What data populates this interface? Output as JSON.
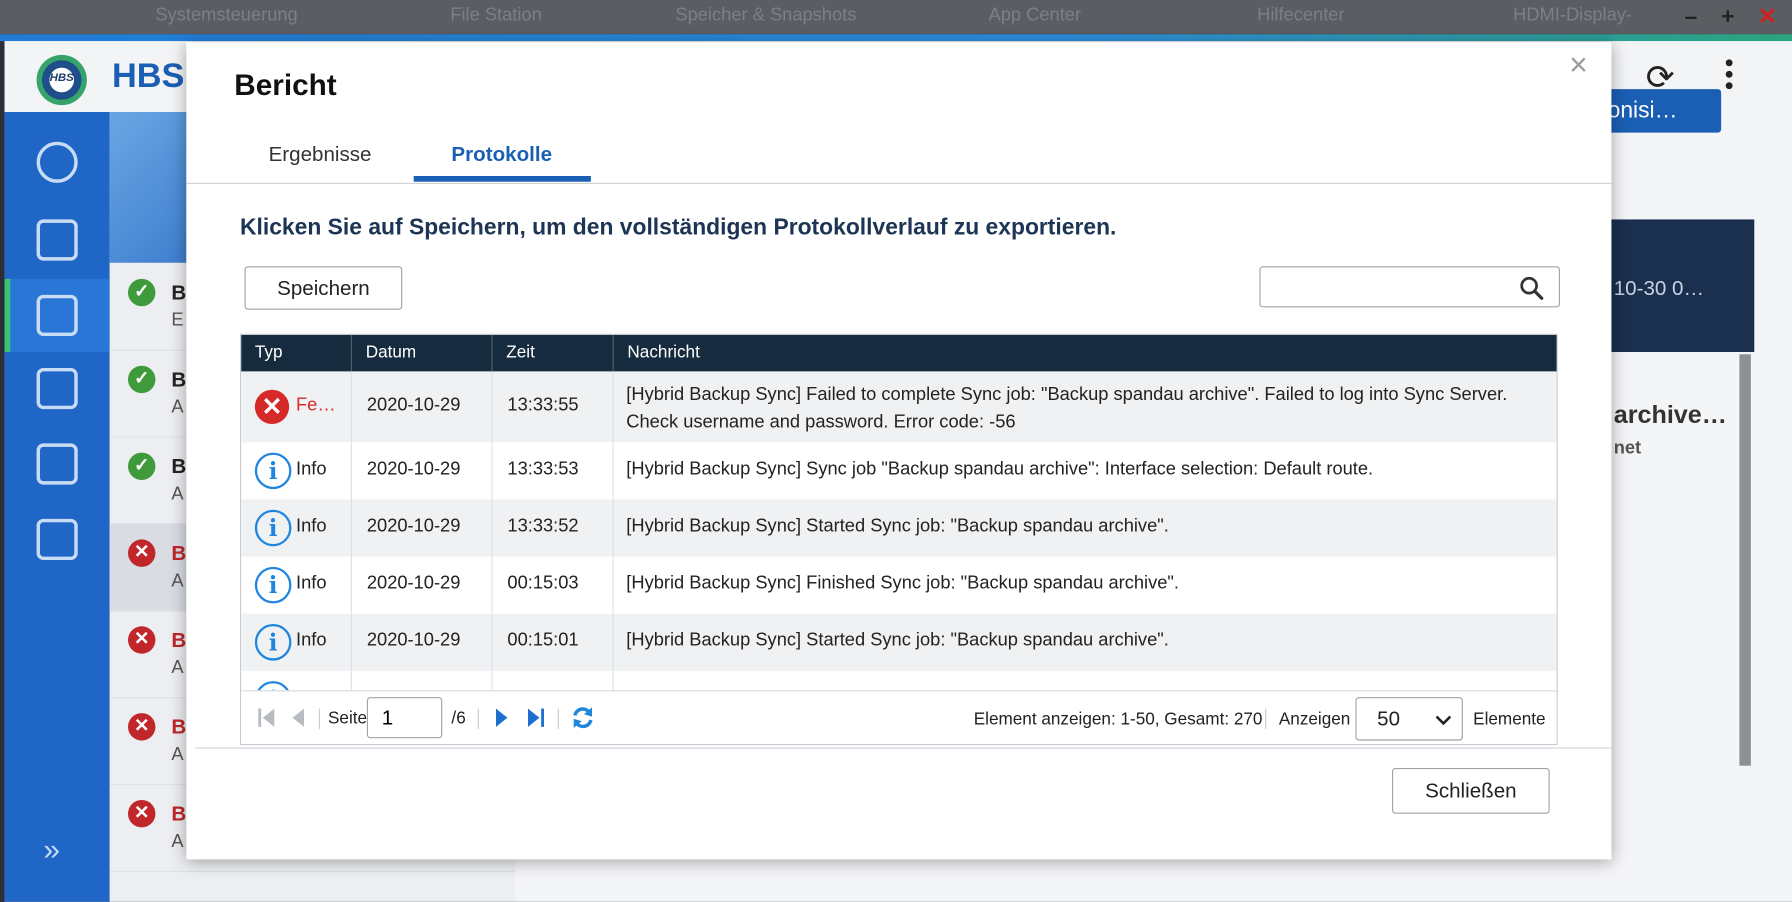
{
  "system_bar": {
    "items": [
      "Systemsteuerung",
      "File Station",
      "Speicher & Snapshots",
      "App Center",
      "Hilfecenter",
      "HDMI-Display-"
    ],
    "minimize_label": "–",
    "maximize_label": "+",
    "close_label": "✕"
  },
  "app": {
    "name": "HBS",
    "logo_text": "HBS",
    "sync_button_label": "ronisi…",
    "detail_date": "10-30 0…",
    "detail_title": "archive…",
    "detail_sub": "net",
    "collapse_label": "»",
    "job_list": [
      {
        "status": "ok",
        "title": "B",
        "sub": "E"
      },
      {
        "status": "ok",
        "title": "B",
        "sub": "A"
      },
      {
        "status": "ok",
        "title": "B",
        "sub": "A"
      },
      {
        "status": "err",
        "title": "B",
        "sub": "A"
      },
      {
        "status": "err",
        "title": "B",
        "sub": "A"
      },
      {
        "status": "err",
        "title": "B",
        "sub": "A"
      },
      {
        "status": "err",
        "title": "B",
        "sub": "A"
      }
    ]
  },
  "dialog": {
    "title": "Bericht",
    "close_icon_label": "×",
    "tabs": [
      {
        "label": "Ergebnisse",
        "active": false
      },
      {
        "label": "Protokolle",
        "active": true
      }
    ],
    "hint": "Klicken Sie auf Speichern, um den vollständigen Protokollverlauf zu exportieren.",
    "save_label": "Speichern",
    "search_placeholder": "",
    "table": {
      "columns": [
        "Typ",
        "Datum",
        "Zeit",
        "Nachricht"
      ],
      "rows": [
        {
          "type": "Fe…",
          "level": "error",
          "date": "2020-10-29",
          "time": "13:33:55",
          "message": "[Hybrid Backup Sync] Failed to complete Sync job: \"Backup spandau archive\". Failed to log into Sync Server. Check username and password. Error code: -56"
        },
        {
          "type": "Info",
          "level": "info",
          "date": "2020-10-29",
          "time": "13:33:53",
          "message": "[Hybrid Backup Sync] Sync job \"Backup spandau archive\": Interface selection: Default route."
        },
        {
          "type": "Info",
          "level": "info",
          "date": "2020-10-29",
          "time": "13:33:52",
          "message": "[Hybrid Backup Sync] Started Sync job: \"Backup spandau archive\"."
        },
        {
          "type": "Info",
          "level": "info",
          "date": "2020-10-29",
          "time": "00:15:03",
          "message": "[Hybrid Backup Sync] Finished Sync job: \"Backup spandau archive\"."
        },
        {
          "type": "Info",
          "level": "info",
          "date": "2020-10-29",
          "time": "00:15:01",
          "message": "[Hybrid Backup Sync] Started Sync job: \"Backup spandau archive\"."
        }
      ]
    },
    "pager": {
      "page_label": "Seite",
      "page_value": "1",
      "total_pages": "/6",
      "summary": "Element anzeigen: 1-50, Gesamt: 270",
      "show_label": "Anzeigen",
      "page_size": "50",
      "items_label": "Elemente"
    },
    "close_button_label": "Schließen"
  },
  "colors": {
    "accent_blue": "#1a5fb4",
    "table_header": "#162b3d",
    "error_red": "#d62a2a",
    "info_blue": "#1f86e0"
  }
}
